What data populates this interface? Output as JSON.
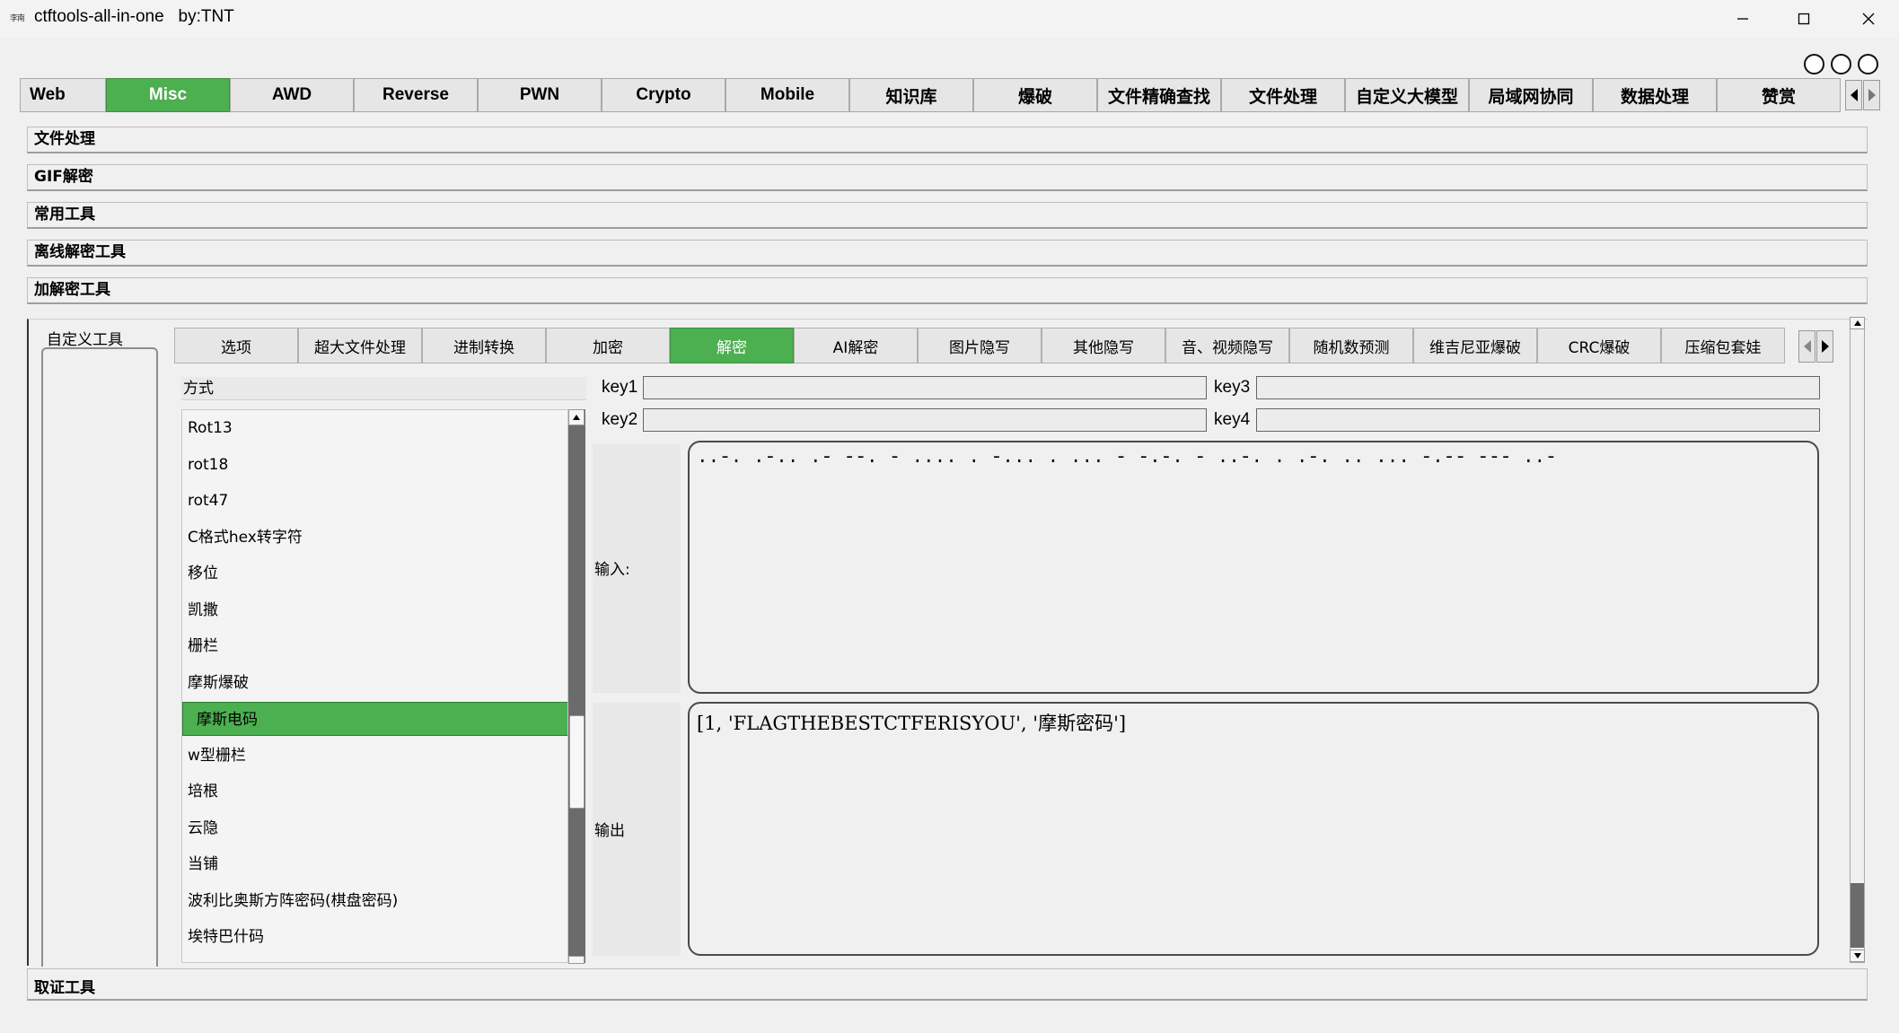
{
  "window": {
    "icon_text": "李南",
    "title": "ctftools-all-in-one   by:TNT",
    "controls": [
      "minimize-icon",
      "maximize-icon",
      "close-icon"
    ]
  },
  "main_tabs": [
    {
      "label": "Web"
    },
    {
      "label": "Misc",
      "active": true
    },
    {
      "label": "AWD"
    },
    {
      "label": "Reverse"
    },
    {
      "label": "PWN"
    },
    {
      "label": "Crypto"
    },
    {
      "label": "Mobile"
    },
    {
      "label": "知识库"
    },
    {
      "label": "爆破"
    },
    {
      "label": "文件精确查找"
    },
    {
      "label": "文件处理"
    },
    {
      "label": "自定义大模型"
    },
    {
      "label": "局域网协同"
    },
    {
      "label": "数据处理"
    },
    {
      "label": "赞赏"
    }
  ],
  "sections": [
    "文件处理",
    "GIF解密",
    "常用工具",
    "离线解密工具",
    "加解密工具"
  ],
  "custom_tools_label": "自定义工具",
  "sub_tabs": [
    {
      "label": "选项"
    },
    {
      "label": "超大文件处理"
    },
    {
      "label": "进制转换"
    },
    {
      "label": "加密"
    },
    {
      "label": "解密",
      "active": true
    },
    {
      "label": "AI解密"
    },
    {
      "label": "图片隐写"
    },
    {
      "label": "其他隐写"
    },
    {
      "label": "音、视频隐写"
    },
    {
      "label": "随机数预测"
    },
    {
      "label": "维吉尼亚爆破"
    },
    {
      "label": "CRC爆破"
    },
    {
      "label": "压缩包套娃"
    }
  ],
  "method_header": "方式",
  "methods": [
    "Rot13",
    "rot18",
    "rot47",
    "C格式hex转字符",
    "移位",
    "凯撒",
    "栅栏",
    "摩斯爆破",
    "摩斯电码",
    "w型栅栏",
    "培根",
    "云隐",
    "当铺",
    "波利比奥斯方阵密码(棋盘密码)",
    "埃特巴什码"
  ],
  "selected_method": "摩斯电码",
  "keys": {
    "key1": "key1",
    "key2": "key2",
    "key3": "key3",
    "key4": "key4"
  },
  "input_label": "输入:",
  "output_label": "输出",
  "input_text": "..-. .-.. .- --. - .... . -... . ... - -.-. - ..-. . .-. .. ... -.-- --- ..-",
  "output_text": "[1, 'FLAGTHEBESTCTFERISYOU', '摩斯密码']",
  "bottom_section": "取证工具",
  "colors": {
    "accent": "#4caf50",
    "background": "#f0f0f0"
  }
}
